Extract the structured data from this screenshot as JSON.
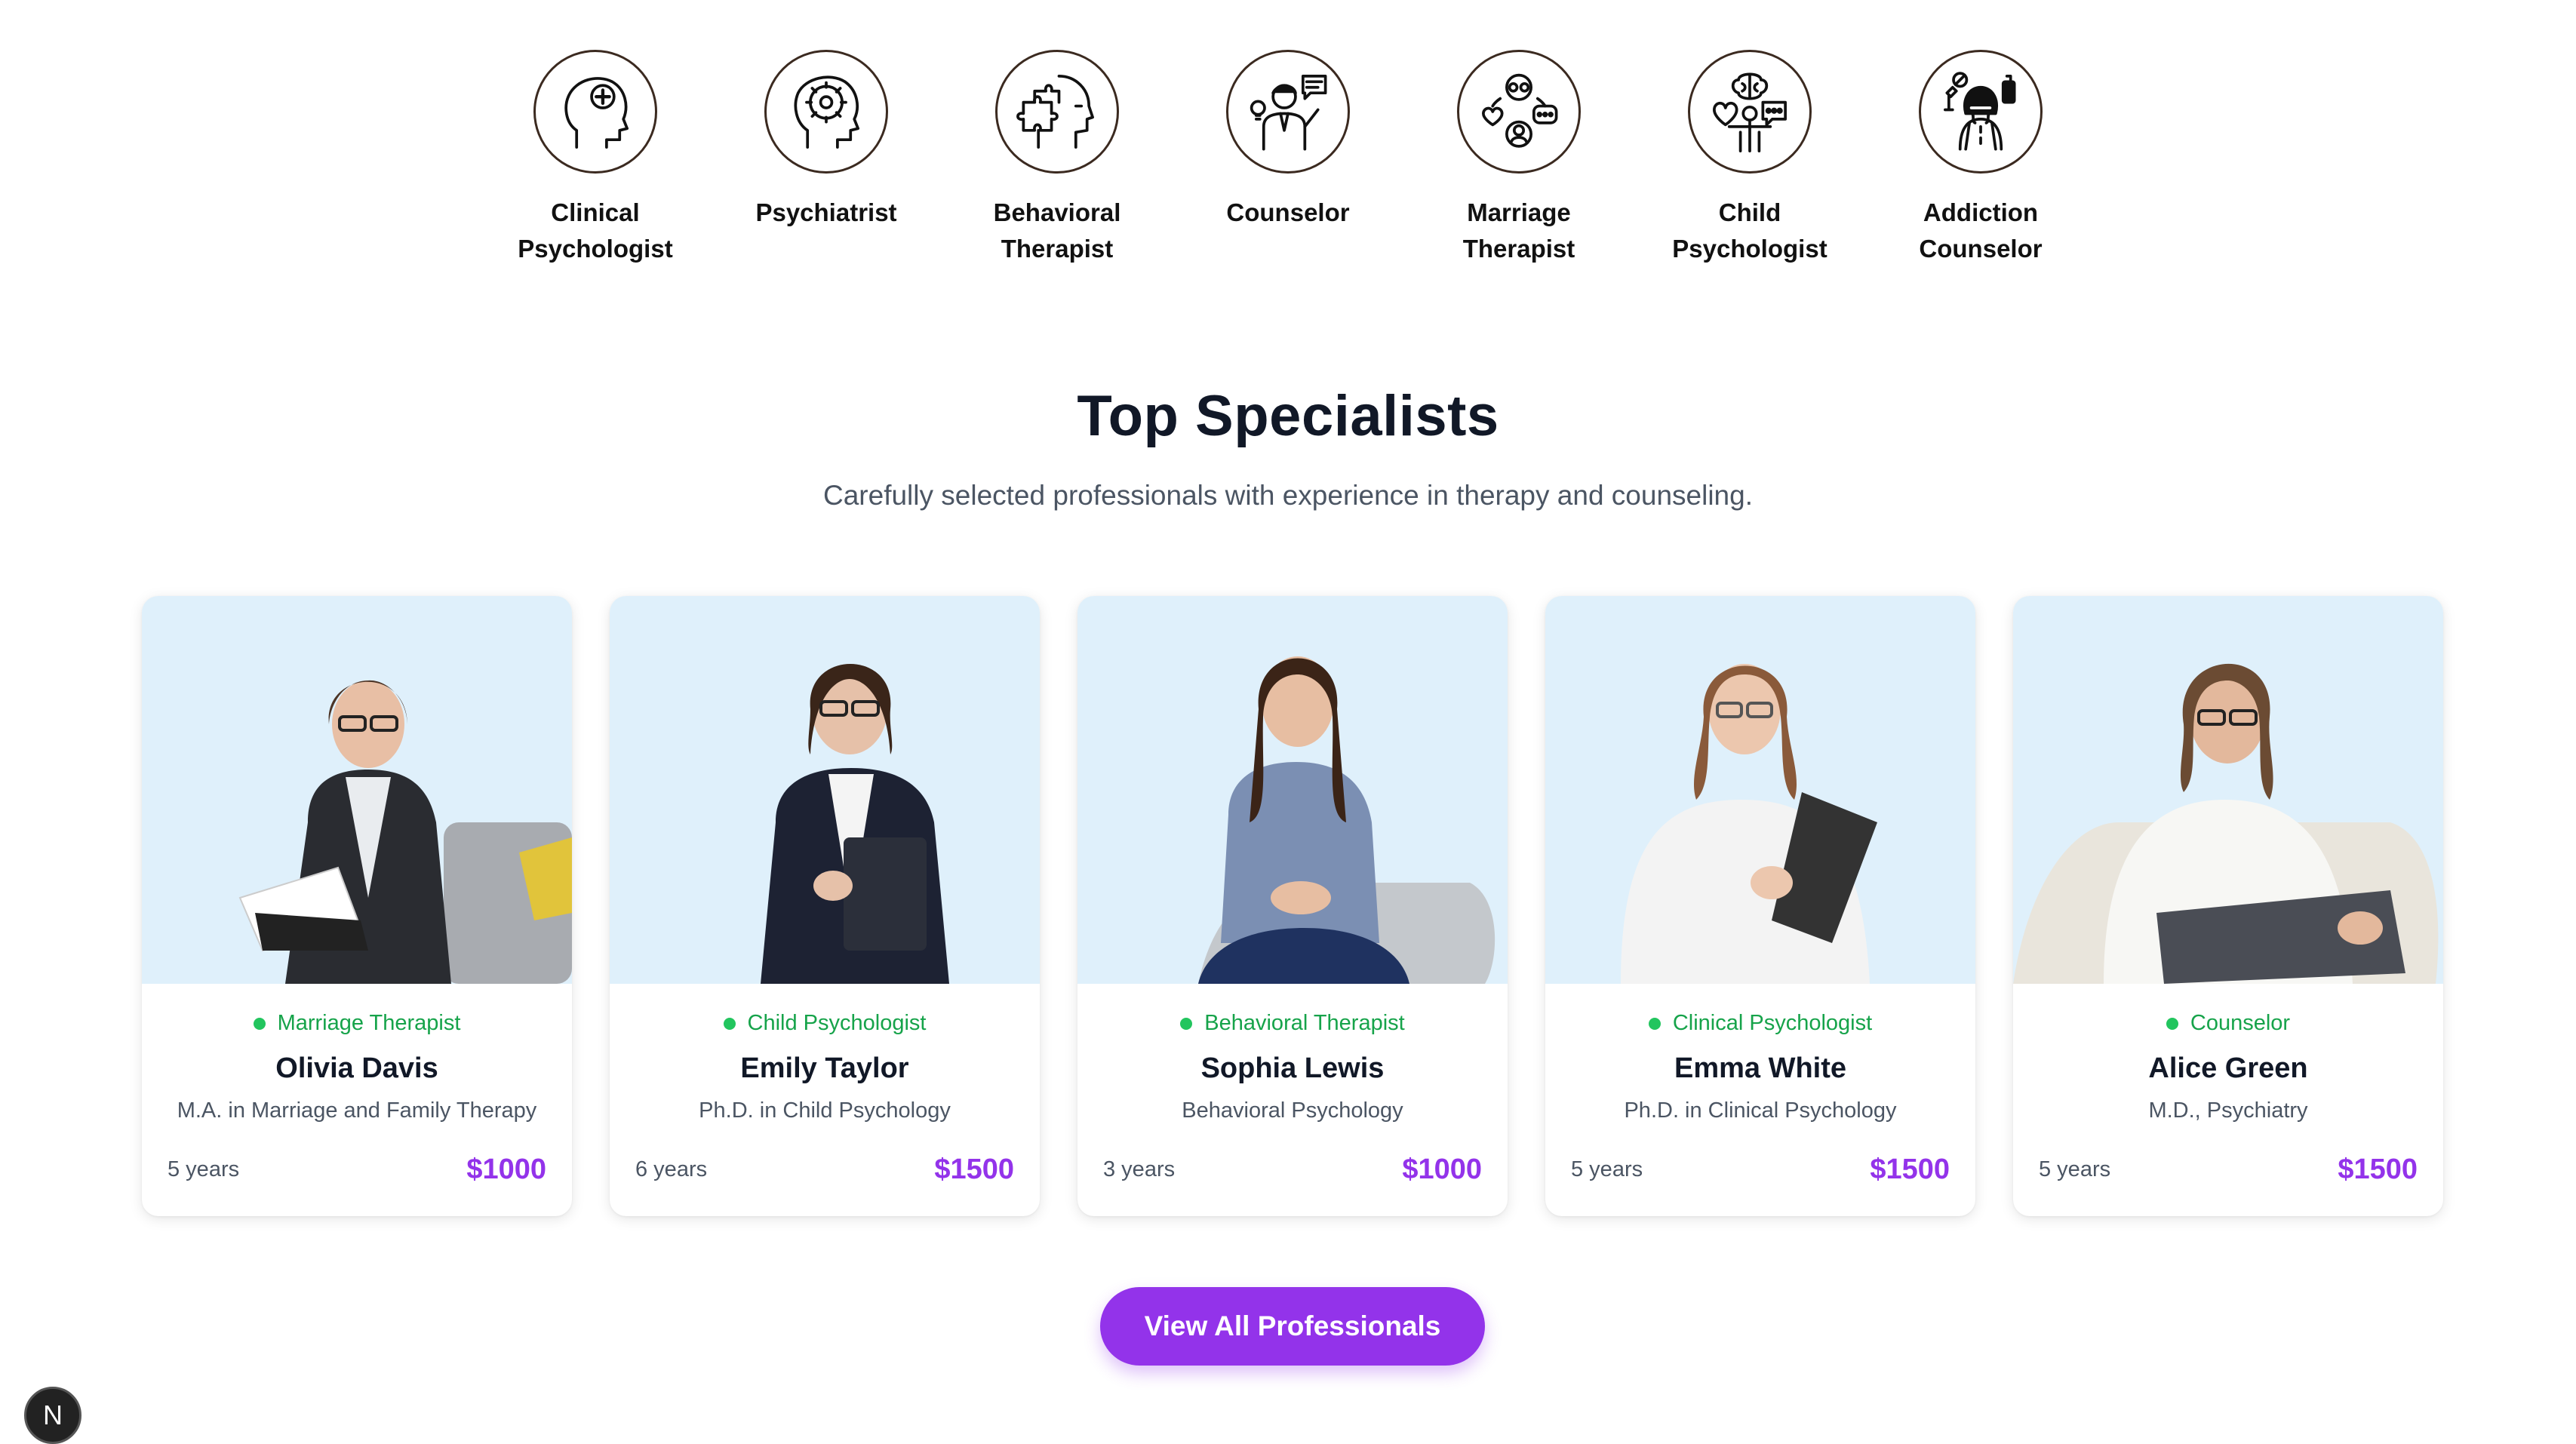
{
  "categories": [
    {
      "label": "Clinical\nPsychologist",
      "icon": "head-plus-icon"
    },
    {
      "label": "Psychiatrist",
      "icon": "brain-gear-icon"
    },
    {
      "label": "Behavioral\nTherapist",
      "icon": "puzzle-head-icon"
    },
    {
      "label": "Counselor",
      "icon": "counselor-speaking-icon"
    },
    {
      "label": "Marriage\nTherapist",
      "icon": "couple-heart-icon"
    },
    {
      "label": "Child\nPsychologist",
      "icon": "child-brain-icon"
    },
    {
      "label": "Addiction\nCounselor",
      "icon": "addiction-icon"
    }
  ],
  "section": {
    "title": "Top Specialists",
    "subtitle": "Carefully selected professionals with experience in therapy and counseling."
  },
  "specialists": [
    {
      "specialty": "Marriage Therapist",
      "name": "Olivia Davis",
      "degree": "M.A. in Marriage and Family Therapy",
      "experience": "5 years",
      "price": "$1000"
    },
    {
      "specialty": "Child Psychologist",
      "name": "Emily Taylor",
      "degree": "Ph.D. in Child Psychology",
      "experience": "6 years",
      "price": "$1500"
    },
    {
      "specialty": "Behavioral Therapist",
      "name": "Sophia Lewis",
      "degree": "Behavioral Psychology",
      "experience": "3 years",
      "price": "$1000"
    },
    {
      "specialty": "Clinical Psychologist",
      "name": "Emma White",
      "degree": "Ph.D. in Clinical Psychology",
      "experience": "5 years",
      "price": "$1500"
    },
    {
      "specialty": "Counselor",
      "name": "Alice Green",
      "degree": "M.D., Psychiatry",
      "experience": "5 years",
      "price": "$1500"
    }
  ],
  "cta": {
    "label": "View All Professionals"
  },
  "dev_badge": {
    "label": "N"
  },
  "colors": {
    "accent": "#9333ea",
    "status": "#22c55e",
    "photo_bg": "#dff0fb"
  }
}
